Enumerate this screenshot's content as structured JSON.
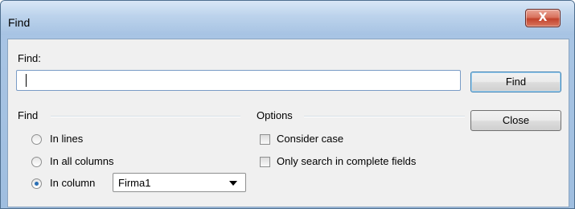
{
  "window": {
    "title": "Find",
    "close_icon": "x-icon",
    "close_glyph": "X"
  },
  "search": {
    "label": "Find:",
    "value": "",
    "placeholder": ""
  },
  "buttons": {
    "find": "Find",
    "close": "Close"
  },
  "find_group": {
    "label": "Find",
    "options": [
      {
        "label": "In lines",
        "checked": false
      },
      {
        "label": "In all columns",
        "checked": false
      },
      {
        "label": "In column",
        "checked": true
      }
    ],
    "column_select": {
      "selected": "Firma1"
    }
  },
  "options_group": {
    "label": "Options",
    "items": [
      {
        "label": "Consider case",
        "checked": false
      },
      {
        "label": "Only search in complete fields",
        "checked": false
      }
    ]
  },
  "colors": {
    "titlebar": "#bcd3ec",
    "close_button": "#c2432d",
    "client_bg": "#f0f0f0",
    "radio_dot": "#2a6fb5"
  }
}
